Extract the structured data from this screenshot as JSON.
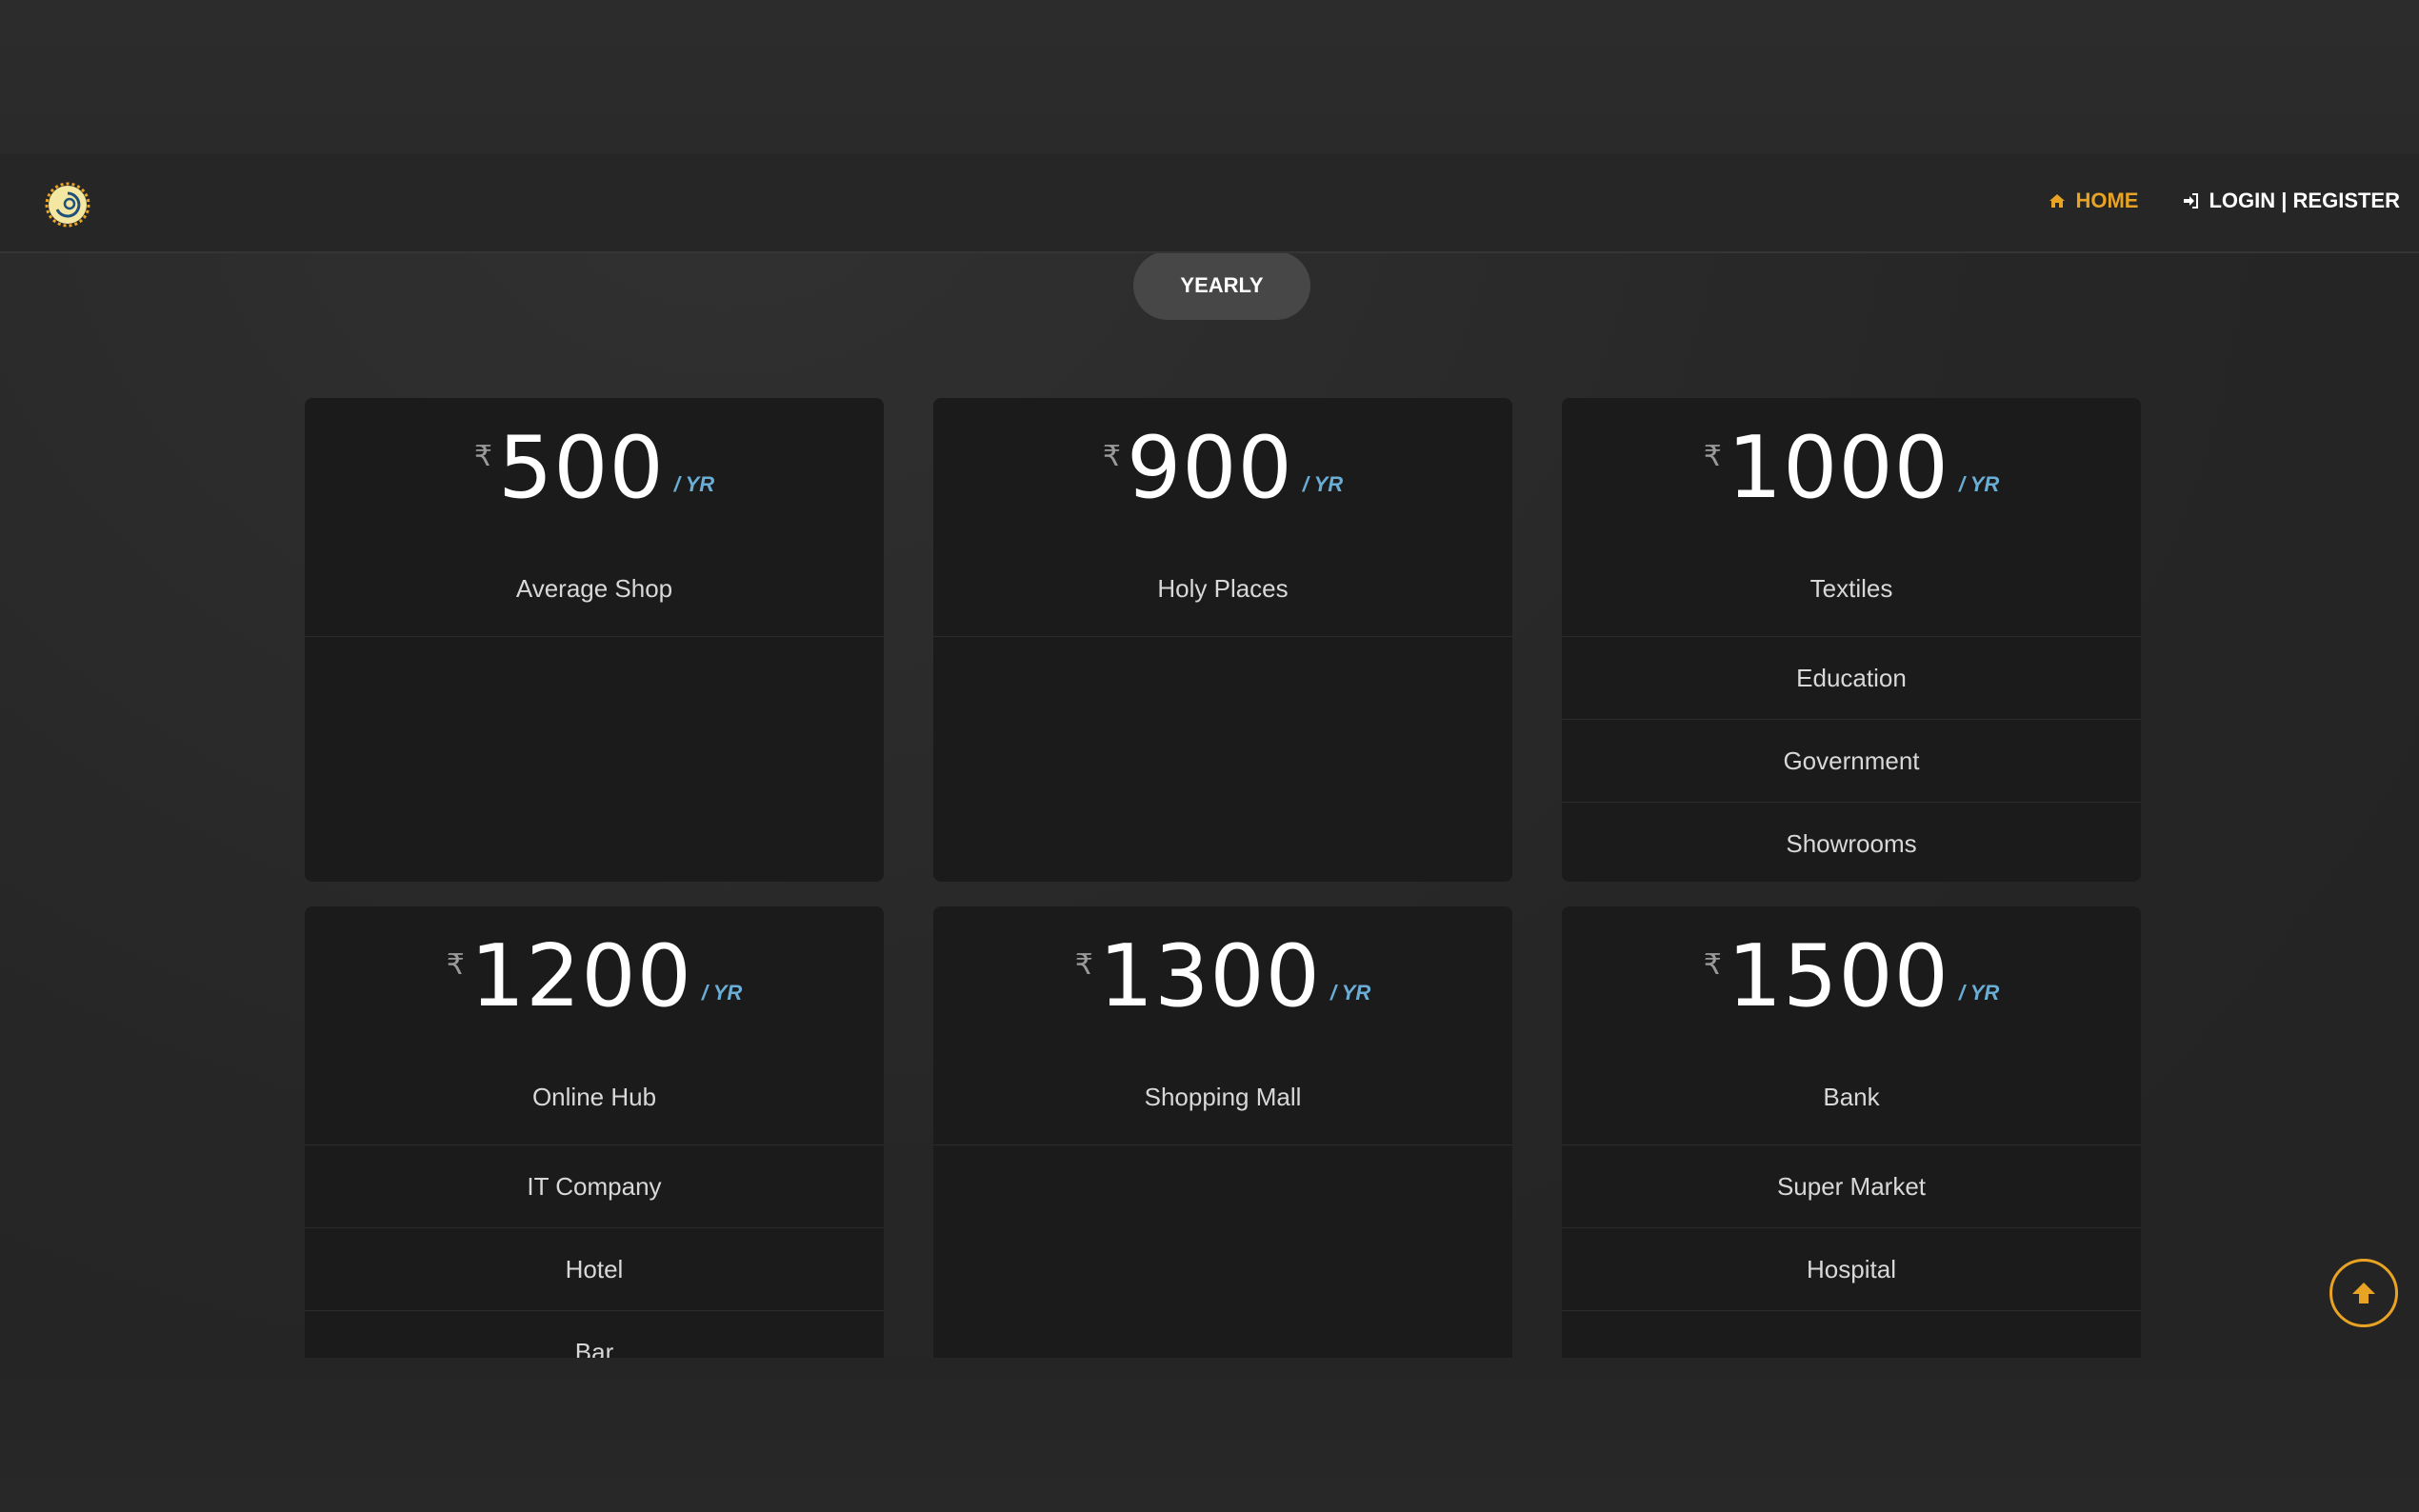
{
  "nav": {
    "home_label": "HOME",
    "login_label": "LOGIN | REGISTER",
    "home_icon": "home-icon",
    "login_icon": "sign-in-icon",
    "accent_color": "#e8a325"
  },
  "toggle": {
    "label": "YEARLY"
  },
  "plans": [
    {
      "currency": "₹",
      "amount": "500",
      "per": "/ YR",
      "features": [
        "Average Shop"
      ]
    },
    {
      "currency": "₹",
      "amount": "900",
      "per": "/ YR",
      "features": [
        "Holy Places"
      ]
    },
    {
      "currency": "₹",
      "amount": "1000",
      "per": "/ YR",
      "features": [
        "Textiles",
        "Education",
        "Government",
        "Showrooms"
      ]
    },
    {
      "currency": "₹",
      "amount": "1200",
      "per": "/ YR",
      "features": [
        "Online Hub",
        "IT Company",
        "Hotel",
        "Bar"
      ]
    },
    {
      "currency": "₹",
      "amount": "1300",
      "per": "/ YR",
      "features": [
        "Shopping Mall"
      ]
    },
    {
      "currency": "₹",
      "amount": "1500",
      "per": "/ YR",
      "features": [
        "Bank",
        "Super Market",
        "Hospital",
        ""
      ]
    }
  ],
  "scroll_top": {
    "icon": "arrow-up-icon"
  }
}
